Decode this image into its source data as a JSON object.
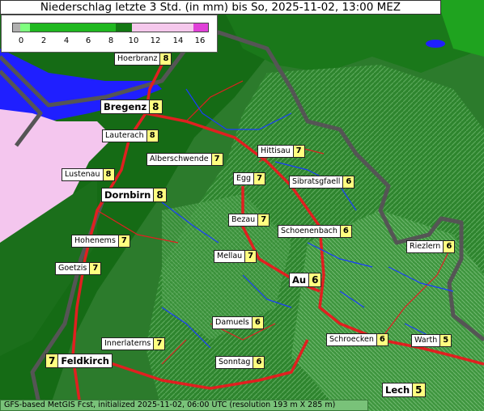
{
  "title": "Niederschlag letzte 3 Std. (in mm) bis So, 2025-11-02, 13:00 MEZ",
  "legend": {
    "ticks": [
      "0",
      "2",
      "4",
      "6",
      "8",
      "10",
      "12",
      "14",
      "16"
    ],
    "colors": [
      "#b0b0b0",
      "#7fff7f",
      "#2ec82e",
      "#1ea01e",
      "#137813",
      "#f5c8ec",
      "#f0a8e4",
      "#e888da",
      "#e040d8"
    ]
  },
  "footer": "GFS-based MetGIS Fcst, initialized 2025-11-02, 06:00 UTC  (resolution 193 m X 285 m)",
  "towns": [
    {
      "name": "Hoerbranz",
      "value": "8"
    },
    {
      "name": "Bregenz",
      "value": "8"
    },
    {
      "name": "Lauterach",
      "value": "8"
    },
    {
      "name": "Alberschwende",
      "value": "7"
    },
    {
      "name": "Hittisau",
      "value": "7"
    },
    {
      "name": "Lustenau",
      "value": "8"
    },
    {
      "name": "Egg",
      "value": "7"
    },
    {
      "name": "Sibratsgfaell",
      "value": "6"
    },
    {
      "name": "Dornbirn",
      "value": "8"
    },
    {
      "name": "Bezau",
      "value": "7"
    },
    {
      "name": "Schoenenbach",
      "value": "6"
    },
    {
      "name": "Hohenems",
      "value": "7"
    },
    {
      "name": "Riezlern",
      "value": "6"
    },
    {
      "name": "Mellau",
      "value": "7"
    },
    {
      "name": "Goetzis",
      "value": "7"
    },
    {
      "name": "Au",
      "value": "6"
    },
    {
      "name": "Damuels",
      "value": "6"
    },
    {
      "name": "Innerlaterns",
      "value": "7"
    },
    {
      "name": "Schroecken",
      "value": "6"
    },
    {
      "name": "Warth",
      "value": "5"
    },
    {
      "name": "Feldkirch",
      "value": "7"
    },
    {
      "name": "Sonntag",
      "value": "6"
    },
    {
      "name": "Lech",
      "value": "5"
    }
  ],
  "colors": {
    "lake": "#1a1aff",
    "border": "#555555",
    "rivers": "#1a3cff",
    "roads": "#e02020"
  }
}
